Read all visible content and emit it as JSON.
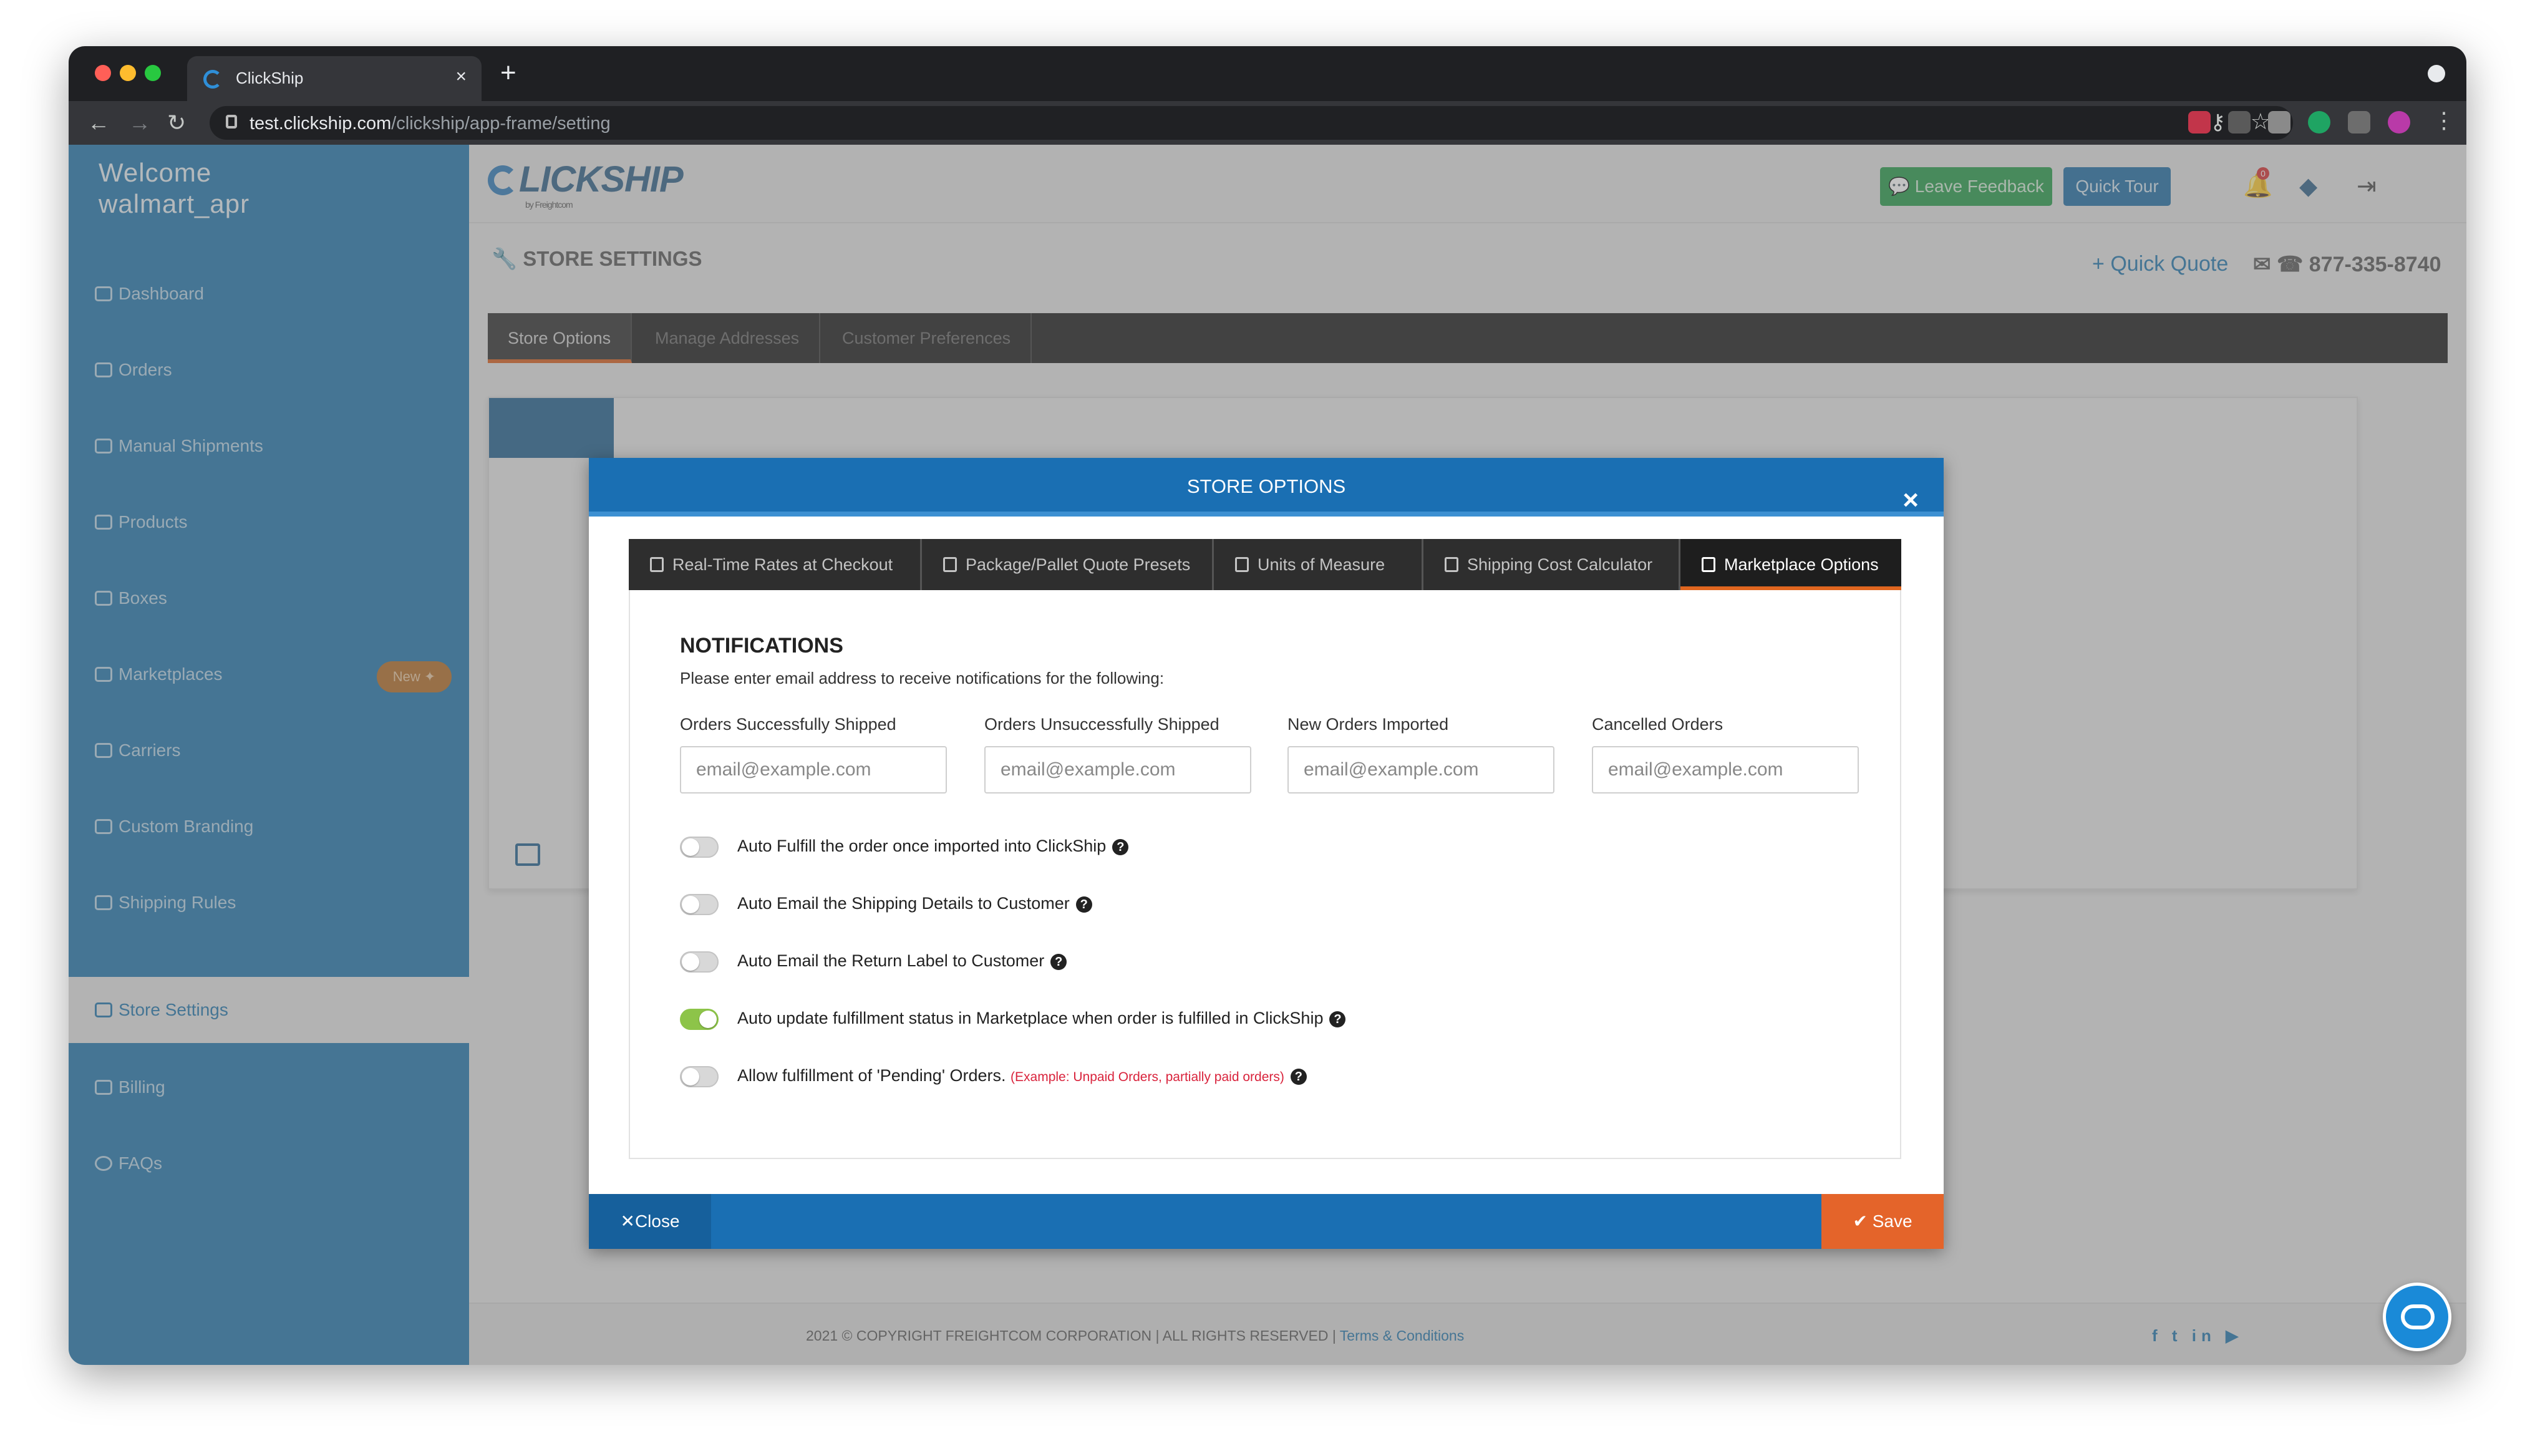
{
  "browser": {
    "tab_title": "ClickShip",
    "tab_close": "×",
    "new_tab": "+",
    "url_domain": "test.clickship.com",
    "url_path": "/clickship/app-frame/setting"
  },
  "sidebar": {
    "welcome_line1": "Welcome",
    "welcome_line2": "walmart_apr",
    "items": [
      {
        "label": "Dashboard",
        "icon": "gauge-icon"
      },
      {
        "label": "Orders",
        "icon": "cart-icon"
      },
      {
        "label": "Manual Shipments",
        "icon": "truck-icon"
      },
      {
        "label": "Products",
        "icon": "tag-icon"
      },
      {
        "label": "Boxes",
        "icon": "box-icon"
      },
      {
        "label": "Marketplaces",
        "icon": "store-icon",
        "badge": "New ✦"
      },
      {
        "label": "Carriers",
        "icon": "truck-icon"
      },
      {
        "label": "Custom Branding",
        "icon": "brush-icon"
      },
      {
        "label": "Shipping Rules",
        "icon": "list-icon"
      },
      {
        "label": "Store Settings",
        "icon": "wrench-icon",
        "active": true
      },
      {
        "label": "Billing",
        "icon": "building-icon"
      },
      {
        "label": "FAQs",
        "icon": "question-icon"
      }
    ]
  },
  "header": {
    "logo_text": "LICKSHIP",
    "logo_sub": "by Freightcom",
    "leave_feedback": "Leave Feedback",
    "quick_tour": "Quick Tour",
    "notification_count": "0"
  },
  "page": {
    "title": "STORE SETTINGS",
    "quick_quote": "Quick Quote",
    "phone": "877-335-8740",
    "tabs": [
      "Store Options",
      "Manage Addresses",
      "Customer Preferences"
    ]
  },
  "modal": {
    "title": "STORE OPTIONS",
    "close_x": "×",
    "tabs": [
      {
        "label": "Real-Time Rates at Checkout",
        "icon": "truck-icon"
      },
      {
        "label": "Package/Pallet Quote Presets",
        "icon": "document-icon"
      },
      {
        "label": "Units of Measure",
        "icon": "ruler-icon"
      },
      {
        "label": "Shipping Cost Calculator",
        "icon": "calculator-icon"
      },
      {
        "label": "Marketplace Options",
        "icon": "document-icon",
        "active": true
      }
    ],
    "notifications_title": "NOTIFICATIONS",
    "notifications_sub": "Please enter email address to receive notifications for the following:",
    "fields": [
      {
        "label": "Orders Successfully Shipped",
        "placeholder": "email@example.com"
      },
      {
        "label": "Orders Unsuccessfully Shipped",
        "placeholder": "email@example.com"
      },
      {
        "label": "New Orders Imported",
        "placeholder": "email@example.com"
      },
      {
        "label": "Cancelled Orders",
        "placeholder": "email@example.com"
      }
    ],
    "toggles": [
      {
        "label": "Auto Fulfill the order once imported into ClickShip",
        "on": false
      },
      {
        "label": "Auto Email the Shipping Details to Customer",
        "on": false
      },
      {
        "label": "Auto Email the Return Label to Customer",
        "on": false
      },
      {
        "label": "Auto update fulfillment status in Marketplace when order is fulfilled in ClickShip",
        "on": true
      },
      {
        "label": "Allow fulfillment of 'Pending' Orders.",
        "example": "(Example: Unpaid Orders, partially paid orders)",
        "on": false
      }
    ],
    "help_glyph": "?",
    "close_label": "Close",
    "save_label": "Save"
  },
  "footer": {
    "copyright": "2021 © COPYRIGHT FREIGHTCOM CORPORATION | ALL RIGHTS RESERVED | ",
    "terms": "Terms & Conditions",
    "social": "f t in ▶"
  },
  "colors": {
    "sidebar": "#1c74ab",
    "modal_header": "#1a6fb3",
    "accent_orange": "#e4642a",
    "toggle_on": "#8dc449",
    "feedback_green": "#219a45"
  }
}
